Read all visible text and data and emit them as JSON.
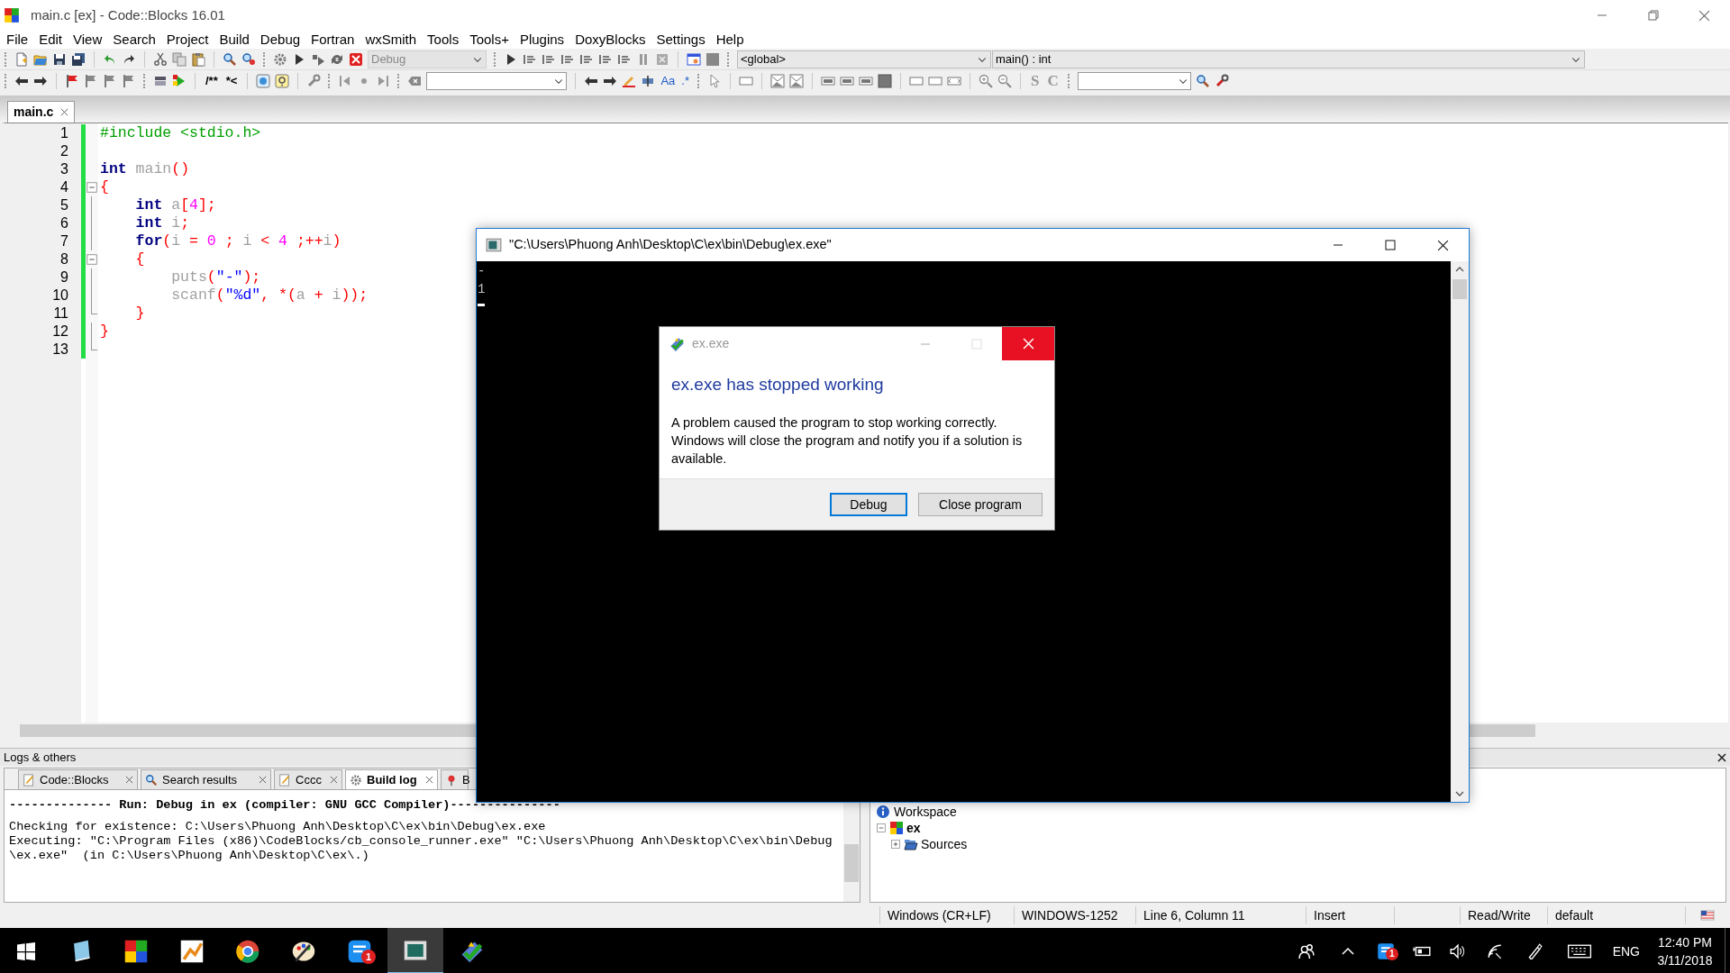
{
  "window": {
    "title": "main.c [ex] - Code::Blocks 16.01"
  },
  "menu": [
    {
      "label": "File"
    },
    {
      "label": "Edit"
    },
    {
      "label": "View"
    },
    {
      "label": "Search"
    },
    {
      "label": "Project"
    },
    {
      "label": "Build"
    },
    {
      "label": "Debug"
    },
    {
      "label": "Fortran"
    },
    {
      "label": "wxSmith"
    },
    {
      "label": "Tools"
    },
    {
      "label": "Tools+"
    },
    {
      "label": "Plugins"
    },
    {
      "label": "DoxyBlocks"
    },
    {
      "label": "Settings"
    },
    {
      "label": "Help"
    }
  ],
  "toolbar": {
    "build_target": "Debug",
    "build_target_disabled": true,
    "scope": "<global>",
    "symbol": "main() : int",
    "comment_buttons": [
      "/**",
      "*<"
    ],
    "search_option_buttons": [
      "Aa",
      ".*"
    ],
    "letter_buttons": [
      "S",
      "C"
    ]
  },
  "editor_tabs": [
    {
      "label": "main.c",
      "selected": true
    }
  ],
  "code_lines": [
    {
      "number": "1",
      "fold_start": false,
      "fold_end": false,
      "tokens": [
        {
          "kind": "preprocessor",
          "text": "#include <stdio.h>"
        }
      ]
    },
    {
      "number": "2",
      "fold_start": false,
      "fold_end": false
    },
    {
      "number": "3",
      "fold_start": false,
      "fold_end": false,
      "tokens": [
        {
          "kind": "keyword",
          "text": "int"
        },
        {
          "kind": "identifier",
          "text": " main"
        },
        {
          "kind": "operator",
          "text": "()"
        }
      ]
    },
    {
      "number": "4",
      "fold_start": true,
      "fold_end": false,
      "tokens": [
        {
          "kind": "operator",
          "text": "{"
        }
      ]
    },
    {
      "number": "5",
      "fold_start": false,
      "fold_end": false,
      "tokens": [
        {
          "kind": "keyword",
          "text": "    int"
        },
        {
          "kind": "identifier",
          "text": " a"
        },
        {
          "kind": "operator",
          "text": "["
        },
        {
          "kind": "number",
          "text": "4"
        },
        {
          "kind": "operator",
          "text": "];"
        }
      ]
    },
    {
      "number": "6",
      "fold_start": false,
      "fold_end": false,
      "tokens": [
        {
          "kind": "keyword",
          "text": "    int"
        },
        {
          "kind": "identifier",
          "text": " i"
        },
        {
          "kind": "operator",
          "text": ";"
        }
      ]
    },
    {
      "number": "7",
      "fold_start": false,
      "fold_end": false,
      "tokens": [
        {
          "kind": "keyword",
          "text": "    for"
        },
        {
          "kind": "operator",
          "text": "("
        },
        {
          "kind": "identifier",
          "text": "i"
        },
        {
          "kind": "operator",
          "text": " = "
        },
        {
          "kind": "number",
          "text": "0"
        },
        {
          "kind": "operator",
          "text": " ; "
        },
        {
          "kind": "identifier",
          "text": "i"
        },
        {
          "kind": "operator",
          "text": " < "
        },
        {
          "kind": "number",
          "text": "4"
        },
        {
          "kind": "operator",
          "text": " ;++"
        },
        {
          "kind": "identifier",
          "text": "i"
        },
        {
          "kind": "operator",
          "text": ")"
        }
      ]
    },
    {
      "number": "8",
      "fold_start": true,
      "fold_end": false,
      "tokens": [
        {
          "kind": "operator",
          "text": "    {"
        }
      ]
    },
    {
      "number": "9",
      "fold_start": false,
      "fold_end": false,
      "tokens": [
        {
          "kind": "identifier",
          "text": "        puts"
        },
        {
          "kind": "operator",
          "text": "("
        },
        {
          "kind": "string",
          "text": "\"-\""
        },
        {
          "kind": "operator",
          "text": ");"
        }
      ]
    },
    {
      "number": "10",
      "fold_start": false,
      "fold_end": false,
      "tokens": [
        {
          "kind": "identifier",
          "text": "        scanf"
        },
        {
          "kind": "operator",
          "text": "("
        },
        {
          "kind": "string",
          "text": "\"%d\""
        },
        {
          "kind": "operator",
          "text": ", *("
        },
        {
          "kind": "identifier",
          "text": "a"
        },
        {
          "kind": "operator",
          "text": " + "
        },
        {
          "kind": "identifier",
          "text": "i"
        },
        {
          "kind": "operator",
          "text": "));"
        }
      ]
    },
    {
      "number": "11",
      "fold_start": false,
      "fold_end": true,
      "tokens": [
        {
          "kind": "operator",
          "text": "    }"
        }
      ]
    },
    {
      "number": "12",
      "fold_start": false,
      "fold_end": false,
      "tokens": [
        {
          "kind": "operator",
          "text": "}"
        }
      ]
    },
    {
      "number": "13",
      "fold_start": false,
      "fold_end": true
    }
  ],
  "logs": {
    "title": "Logs & others",
    "tabs": [
      {
        "label": "Code::Blocks",
        "kind": "note",
        "selected": false,
        "closable": true
      },
      {
        "label": "Search results",
        "kind": "search",
        "selected": false,
        "closable": true
      },
      {
        "label": "Cccc",
        "kind": "note",
        "selected": false,
        "closable": true
      },
      {
        "label": "Build log",
        "kind": "gear",
        "selected": true,
        "closable": true
      },
      {
        "label": "B",
        "kind": "pin",
        "selected": false,
        "closable": false
      }
    ],
    "lines": [
      {
        "kind": "blank"
      },
      {
        "kind": "header",
        "text": "-------------- Run: Debug in ex (compiler: GNU GCC Compiler)---------------"
      },
      {
        "kind": "blank"
      },
      {
        "kind": "plain",
        "text": "Checking for existence: C:\\Users\\Phuong Anh\\Desktop\\C\\ex\\bin\\Debug\\ex.exe"
      },
      {
        "kind": "plain",
        "text": "Executing: \"C:\\Program Files (x86)\\CodeBlocks/cb_console_runner.exe\" \"C:\\Users\\Phuong Anh\\Desktop\\C\\ex\\bin\\Debug"
      },
      {
        "kind": "plain",
        "text": "\\ex.exe\"  (in C:\\Users\\Phuong Anh\\Desktop\\C\\ex\\.)"
      }
    ]
  },
  "workspace": {
    "label": "Workspace",
    "children": [
      {
        "label": "ex",
        "expanded": true,
        "children": [
          {
            "label": "Sources",
            "expanded": false
          }
        ]
      }
    ]
  },
  "status_bar": [
    {
      "kind": "text",
      "text": "Windows (CR+LF)"
    },
    {
      "kind": "text",
      "text": "WINDOWS-1252"
    },
    {
      "kind": "text",
      "text": "Line 6, Column 11"
    },
    {
      "kind": "text",
      "text": "Insert"
    },
    {
      "kind": "empty"
    },
    {
      "kind": "text",
      "text": "Read/Write"
    },
    {
      "kind": "text",
      "text": "default"
    }
  ],
  "console": {
    "title": "\"C:\\Users\\Phuong Anh\\Desktop\\C\\ex\\bin\\Debug\\ex.exe\"",
    "lines": [
      "-",
      "1"
    ]
  },
  "dialog": {
    "title": "ex.exe",
    "heading": "ex.exe has stopped working",
    "message": [
      "A problem caused the program to stop working correctly.",
      "Windows will close the program and notify you if a solution is available."
    ],
    "buttons": [
      {
        "label": "Debug",
        "default": true
      },
      {
        "label": "Close program",
        "default": false
      }
    ]
  },
  "taskbar": {
    "apps": [
      {
        "kind": "book",
        "active": false
      },
      {
        "kind": "grid",
        "active": false
      },
      {
        "kind": "chart",
        "active": false
      },
      {
        "kind": "browser",
        "active": false
      },
      {
        "kind": "palette",
        "active": false
      },
      {
        "kind": "chat",
        "active": false,
        "badge": "1"
      },
      {
        "kind": "console",
        "active": true
      },
      {
        "kind": "blocks",
        "active": false
      }
    ],
    "tray_badge": "1",
    "language": "ENG",
    "time": "12:40 PM",
    "date": "3/11/2018"
  }
}
